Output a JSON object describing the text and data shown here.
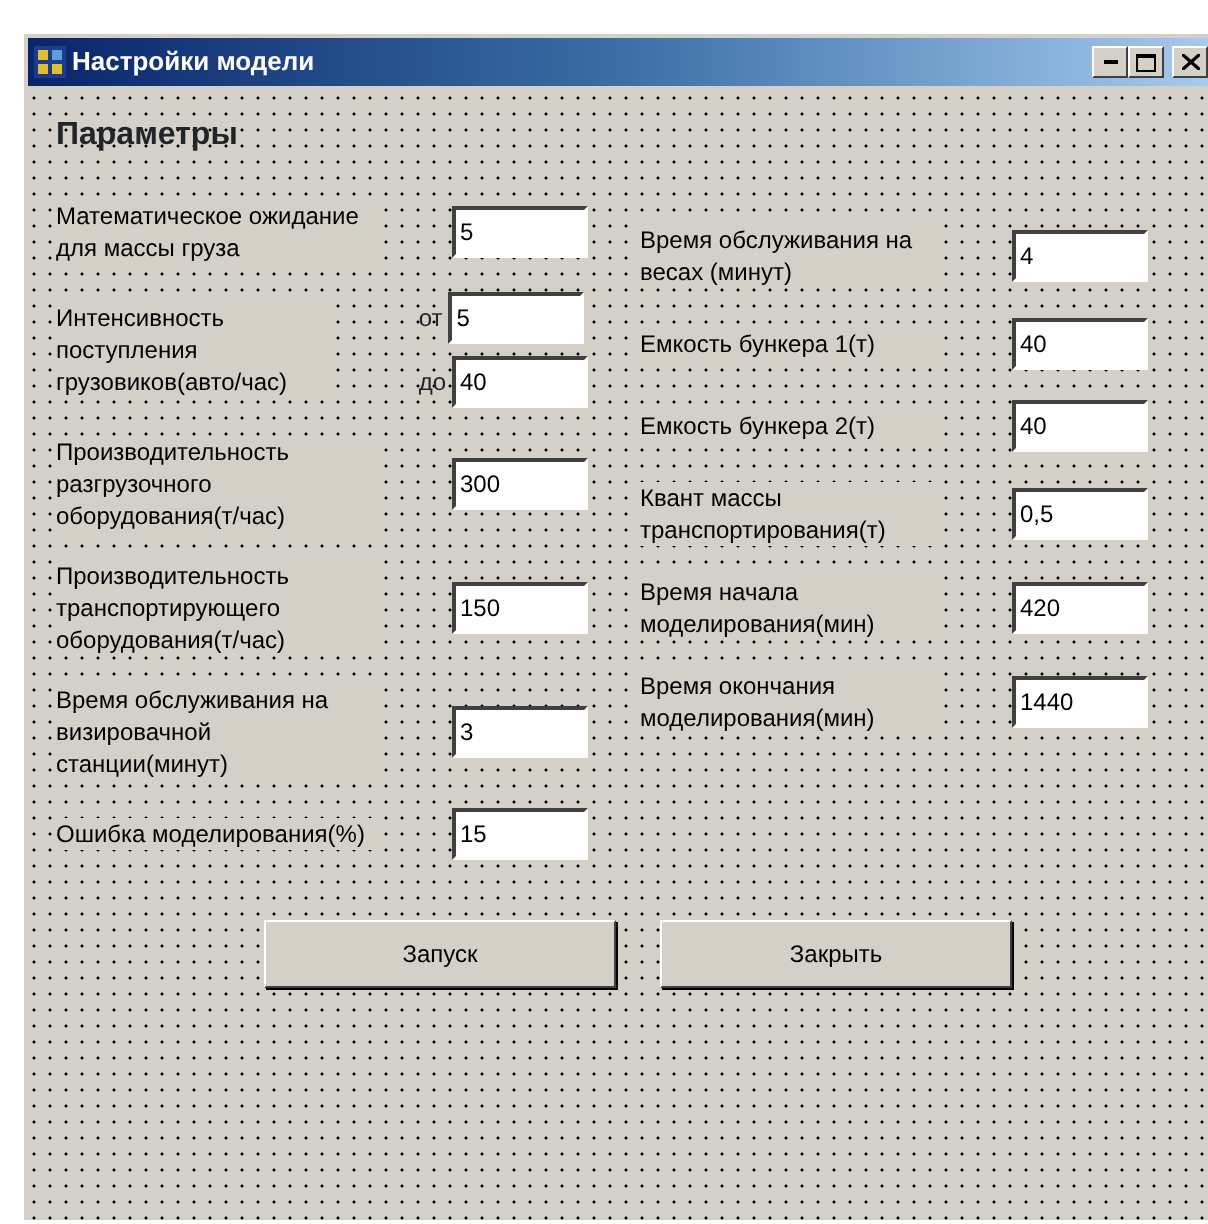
{
  "window": {
    "title": "Настройки модели"
  },
  "heading": "Параметры",
  "left_fields": [
    {
      "kind": "single",
      "label": "Математическое ожидание для массы груза",
      "value": "5"
    },
    {
      "kind": "range",
      "label": "Интенсивность поступления грузовиков(авто/час)",
      "from_label": "от",
      "from_value": "5",
      "to_label": "до",
      "to_value": "40"
    },
    {
      "kind": "single",
      "label": "Производительность разгрузочного оборудования(т/час)",
      "value": "300"
    },
    {
      "kind": "single",
      "label": "Производительность транспортирующего оборудования(т/час)",
      "value": "150"
    },
    {
      "kind": "single",
      "label": "Время обслуживания на визировачной станции(минут)",
      "value": "3"
    },
    {
      "kind": "single",
      "label": "Ошибка моделирования(%)",
      "value": "15"
    }
  ],
  "right_fields": [
    {
      "kind": "single",
      "label": "Время обслуживания на весах (минут)",
      "value": "4"
    },
    {
      "kind": "single",
      "label": "Емкость бункера 1(т)",
      "value": "40"
    },
    {
      "kind": "single",
      "label": "Емкость бункера 2(т)",
      "value": "40"
    },
    {
      "kind": "single",
      "label": "Квант массы транспортирования(т)",
      "value": "0,5"
    },
    {
      "kind": "single",
      "label": "Время начала моделирования(мин)",
      "value": "420"
    },
    {
      "kind": "single",
      "label": "Время окончания моделирования(мин)",
      "value": "1440"
    }
  ],
  "buttons": [
    "Запуск",
    "Закрыть"
  ]
}
